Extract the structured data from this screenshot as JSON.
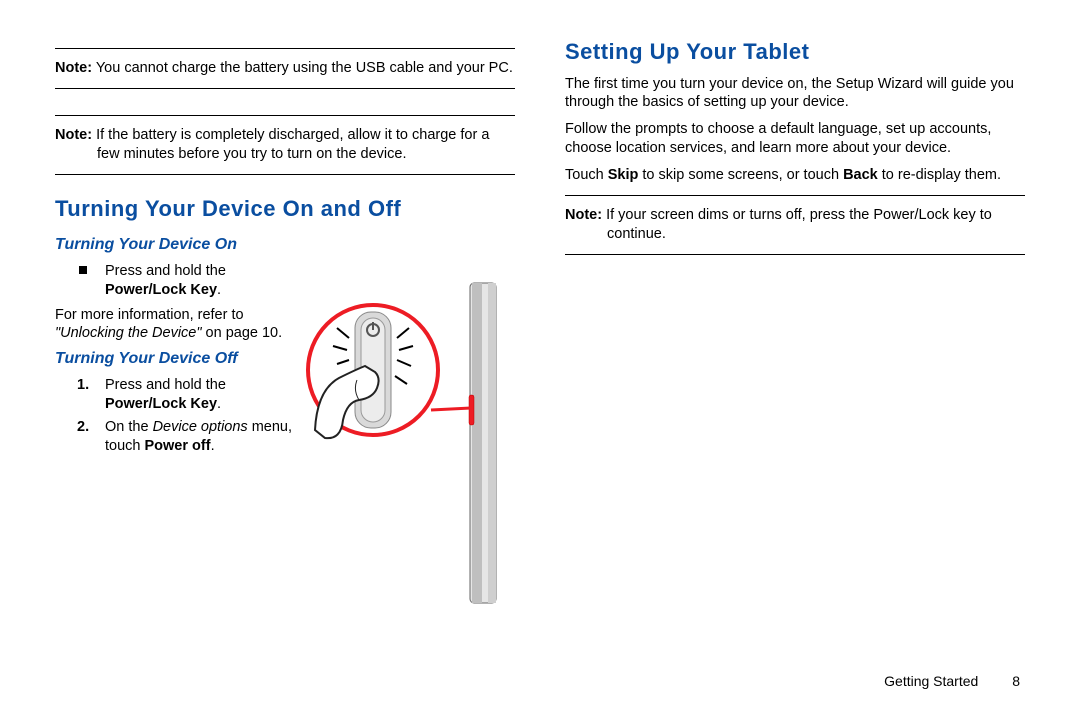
{
  "left": {
    "note1": {
      "label": "Note:",
      "text": "You cannot charge the battery using the USB cable and your PC."
    },
    "note2": {
      "label": "Note:",
      "text": "If the battery is completely discharged, allow it to charge for a few minutes before you try to turn on the device."
    },
    "h1": "Turning Your Device On and Off",
    "h2_on": "Turning Your Device On",
    "bullet_prefix": "Press and hold the ",
    "bullet_bold": "Power/Lock Key",
    "bullet_suffix": ".",
    "ref_line_a": "For more information, refer to ",
    "ref_line_b": "\"Unlocking the Device\"",
    "ref_line_c": " on page 10.",
    "h2_off": "Turning Your Device Off",
    "step1_num": "1.",
    "step1_a": "Press and hold the ",
    "step1_b": "Power/Lock Key",
    "step1_c": ".",
    "step2_num": "2.",
    "step2_a": "On the ",
    "step2_b": "Device options",
    "step2_c": " menu, touch ",
    "step2_d": "Power off",
    "step2_e": "."
  },
  "right": {
    "h1": "Setting Up Your Tablet",
    "p1": "The first time you turn your device on, the Setup Wizard will guide you through the basics of setting up your device.",
    "p2": "Follow the prompts to choose a default language, set up accounts, choose location services, and learn more about your device.",
    "p3_a": "Touch ",
    "p3_b": "Skip",
    "p3_c": " to skip some screens, or touch ",
    "p3_d": "Back",
    "p3_e": " to re-display them.",
    "note": {
      "label": "Note:",
      "text": "If your screen dims or turns off, press the Power/Lock key to continue."
    }
  },
  "footer": {
    "section": "Getting Started",
    "page": "8"
  }
}
